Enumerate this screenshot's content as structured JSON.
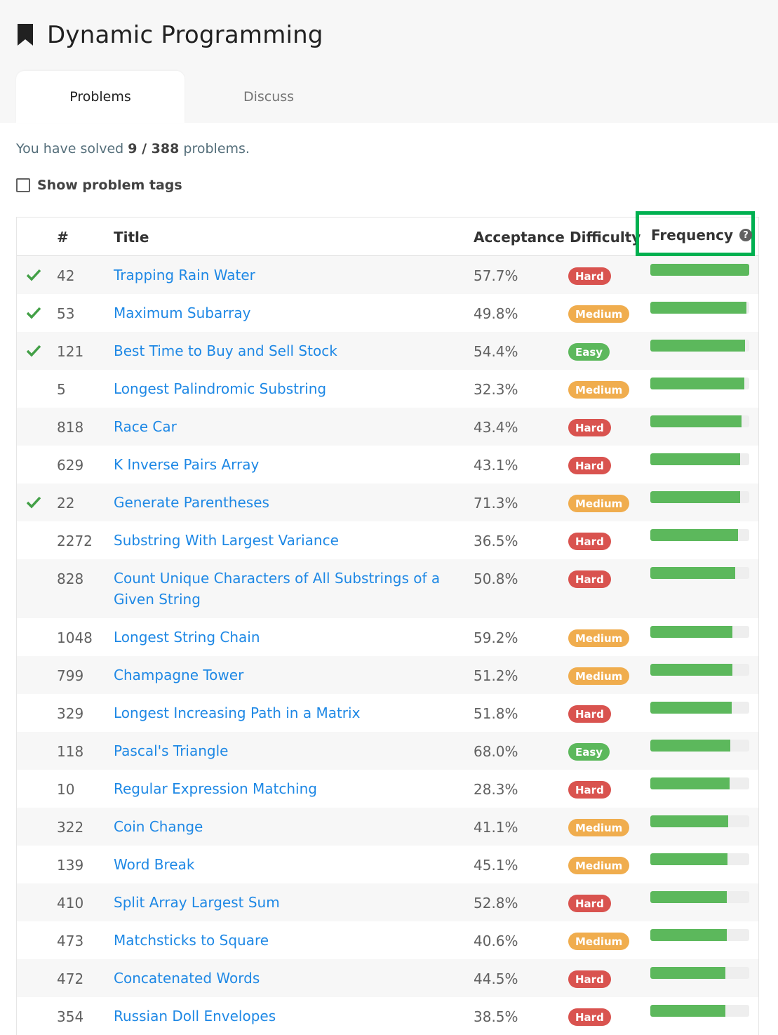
{
  "header": {
    "title": "Dynamic Programming",
    "tabs": [
      {
        "label": "Problems",
        "active": true
      },
      {
        "label": "Discuss",
        "active": false
      }
    ]
  },
  "summary": {
    "prefix": "You have solved ",
    "solved_count": "9 / 388",
    "suffix": " problems."
  },
  "tags_toggle": {
    "label": "Show problem tags",
    "checked": false
  },
  "table": {
    "columns": {
      "number": "#",
      "title": "Title",
      "acceptance": "Acceptance",
      "difficulty": "Difficulty",
      "frequency": "Frequency"
    },
    "rows": [
      {
        "solved": true,
        "num": "42",
        "title": "Trapping Rain Water",
        "acceptance": "57.7%",
        "difficulty": "Hard",
        "frequency": 1.0
      },
      {
        "solved": true,
        "num": "53",
        "title": "Maximum Subarray",
        "acceptance": "49.8%",
        "difficulty": "Medium",
        "frequency": 0.97
      },
      {
        "solved": true,
        "num": "121",
        "title": "Best Time to Buy and Sell Stock",
        "acceptance": "54.4%",
        "difficulty": "Easy",
        "frequency": 0.96
      },
      {
        "solved": false,
        "num": "5",
        "title": "Longest Palindromic Substring",
        "acceptance": "32.3%",
        "difficulty": "Medium",
        "frequency": 0.95
      },
      {
        "solved": false,
        "num": "818",
        "title": "Race Car",
        "acceptance": "43.4%",
        "difficulty": "Hard",
        "frequency": 0.92
      },
      {
        "solved": false,
        "num": "629",
        "title": "K Inverse Pairs Array",
        "acceptance": "43.1%",
        "difficulty": "Hard",
        "frequency": 0.91
      },
      {
        "solved": true,
        "num": "22",
        "title": "Generate Parentheses",
        "acceptance": "71.3%",
        "difficulty": "Medium",
        "frequency": 0.91
      },
      {
        "solved": false,
        "num": "2272",
        "title": "Substring With Largest Variance",
        "acceptance": "36.5%",
        "difficulty": "Hard",
        "frequency": 0.89
      },
      {
        "solved": false,
        "num": "828",
        "title": "Count Unique Characters of All Substrings of a Given String",
        "acceptance": "50.8%",
        "difficulty": "Hard",
        "frequency": 0.86
      },
      {
        "solved": false,
        "num": "1048",
        "title": "Longest String Chain",
        "acceptance": "59.2%",
        "difficulty": "Medium",
        "frequency": 0.83
      },
      {
        "solved": false,
        "num": "799",
        "title": "Champagne Tower",
        "acceptance": "51.2%",
        "difficulty": "Medium",
        "frequency": 0.83
      },
      {
        "solved": false,
        "num": "329",
        "title": "Longest Increasing Path in a Matrix",
        "acceptance": "51.8%",
        "difficulty": "Hard",
        "frequency": 0.82
      },
      {
        "solved": false,
        "num": "118",
        "title": "Pascal's Triangle",
        "acceptance": "68.0%",
        "difficulty": "Easy",
        "frequency": 0.81
      },
      {
        "solved": false,
        "num": "10",
        "title": "Regular Expression Matching",
        "acceptance": "28.3%",
        "difficulty": "Hard",
        "frequency": 0.8
      },
      {
        "solved": false,
        "num": "322",
        "title": "Coin Change",
        "acceptance": "41.1%",
        "difficulty": "Medium",
        "frequency": 0.79
      },
      {
        "solved": false,
        "num": "139",
        "title": "Word Break",
        "acceptance": "45.1%",
        "difficulty": "Medium",
        "frequency": 0.78
      },
      {
        "solved": false,
        "num": "410",
        "title": "Split Array Largest Sum",
        "acceptance": "52.8%",
        "difficulty": "Hard",
        "frequency": 0.77
      },
      {
        "solved": false,
        "num": "473",
        "title": "Matchsticks to Square",
        "acceptance": "40.6%",
        "difficulty": "Medium",
        "frequency": 0.77
      },
      {
        "solved": false,
        "num": "472",
        "title": "Concatenated Words",
        "acceptance": "44.5%",
        "difficulty": "Hard",
        "frequency": 0.76
      },
      {
        "solved": false,
        "num": "354",
        "title": "Russian Doll Envelopes",
        "acceptance": "38.5%",
        "difficulty": "Hard",
        "frequency": 0.76
      }
    ]
  },
  "colors": {
    "link": "#1e88e5",
    "hard": "#d9534f",
    "medium": "#f0ad4e",
    "easy": "#5cb85c",
    "frequency_fill": "#5cb85c",
    "highlight_border": "#00b050"
  },
  "icons": {
    "bookmark": "bookmark-icon",
    "check": "check-icon",
    "help": "question-circle-icon"
  }
}
